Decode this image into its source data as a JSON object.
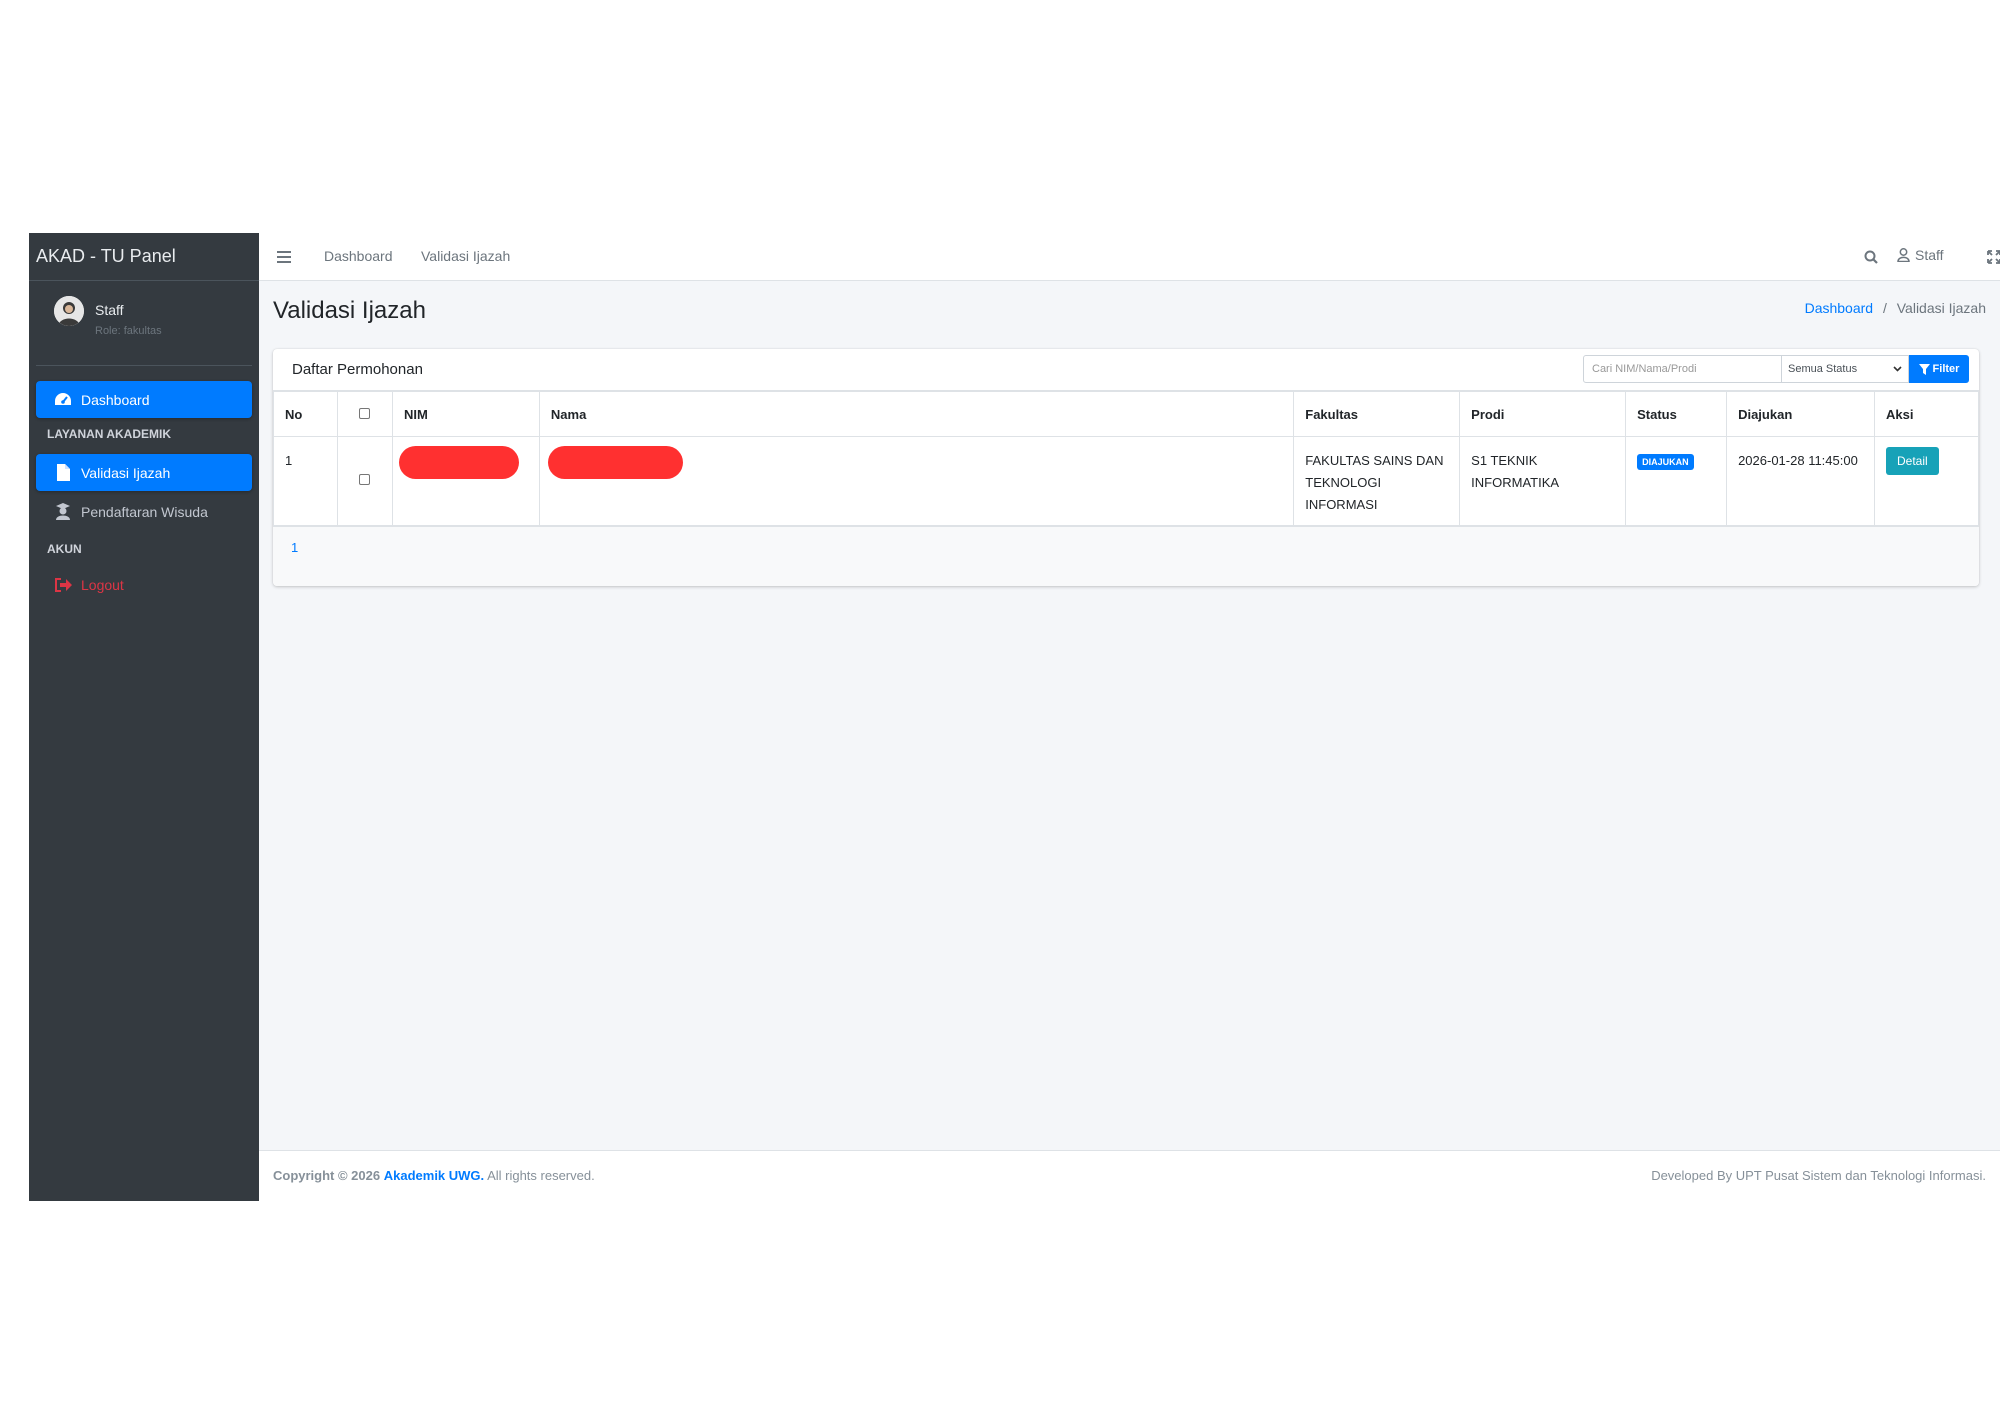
{
  "brand": {
    "title": "AKAD - TU Panel"
  },
  "user": {
    "name": "Staff",
    "role": "Role: fakultas"
  },
  "sidebar": {
    "items": [
      {
        "label": "Dashboard",
        "icon": "dashboard-icon",
        "active": true
      },
      {
        "header": "LAYANAN AKADEMIK"
      },
      {
        "label": "Validasi Ijazah",
        "icon": "file-icon",
        "active": true
      },
      {
        "label": "Pendaftaran Wisuda",
        "icon": "graduate-icon",
        "active": false
      },
      {
        "header": "AKUN"
      },
      {
        "label": "Logout",
        "icon": "logout-icon",
        "active": false
      }
    ]
  },
  "navbar": {
    "links": [
      "Dashboard",
      "Validasi Ijazah"
    ],
    "user_label": "Staff"
  },
  "page": {
    "title": "Validasi Ijazah",
    "breadcrumb": [
      "Dashboard",
      "Validasi Ijazah"
    ]
  },
  "card": {
    "title": "Daftar Permohonan",
    "search_placeholder": "Cari NIM/Nama/Prodi",
    "status_selected": "Semua Status",
    "filter_label": "Filter"
  },
  "table": {
    "headers": [
      "No",
      "",
      "NIM",
      "Nama",
      "Fakultas",
      "Prodi",
      "Status",
      "Diajukan",
      "Aksi"
    ],
    "rows": [
      {
        "no": "1",
        "fakultas": "FAKULTAS SAINS DAN TEKNOLOGI INFORMASI",
        "prodi": "S1 TEKNIK INFORMATIKA",
        "status": "DIAJUKAN",
        "diajukan": "2026-01-28 11:45:00",
        "aksi": "Detail"
      }
    ]
  },
  "pagination": {
    "current": "1"
  },
  "footer": {
    "copyright": "Copyright © 2026",
    "org": "Akademik UWG.",
    "rights": "All rights reserved.",
    "developer": "Developed By UPT Pusat Sistem dan Teknologi Informasi."
  },
  "colors": {
    "primary": "#007bff",
    "sidebar": "#343a40",
    "info": "#17a2b8",
    "danger": "#dc3545",
    "redaction": "#ff3030"
  }
}
